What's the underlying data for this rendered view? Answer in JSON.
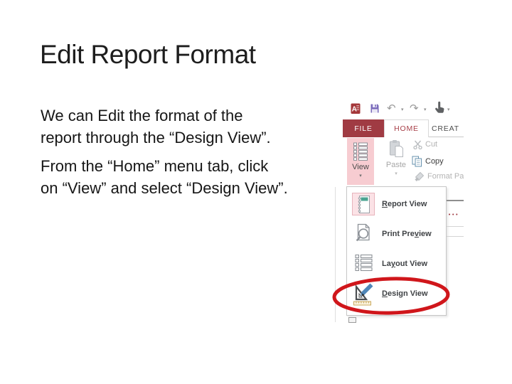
{
  "slide": {
    "title": "Edit Report Format",
    "paragraphs": [
      {
        "line1": "We can Edit the format of the",
        "line2": "report through the “Design View”."
      },
      {
        "line1": "From the “Home” menu tab, click",
        "line2": "on “View” and select “Design View”."
      }
    ]
  },
  "access": {
    "tabs": {
      "file": "FILE",
      "home": "HOME",
      "create": "CREAT"
    },
    "ribbon": {
      "view_label": "View",
      "paste_label": "Paste",
      "cut_label": "Cut",
      "copy_label": "Copy",
      "format_painter_label": "Format Pa"
    },
    "view_menu": {
      "items": [
        {
          "name": "report-view",
          "pre": "",
          "key": "R",
          "post": "eport View"
        },
        {
          "name": "print-preview",
          "pre": "Print Pre",
          "key": "v",
          "post": "iew"
        },
        {
          "name": "layout-view",
          "pre": "La",
          "key": "y",
          "post": "out View"
        },
        {
          "name": "design-view",
          "pre": "",
          "key": "D",
          "post": "esign View"
        }
      ]
    },
    "icons": {
      "caret": "▾",
      "undo": "↶",
      "redo": "↷",
      "dots": "•••"
    },
    "colors": {
      "accent_red": "#a03b43",
      "tab_text_red": "#a84049",
      "highlight_pink": "#f7ccd1",
      "menu_highlight_pink": "#fbe2e6",
      "circle_red": "#d0161b"
    }
  }
}
